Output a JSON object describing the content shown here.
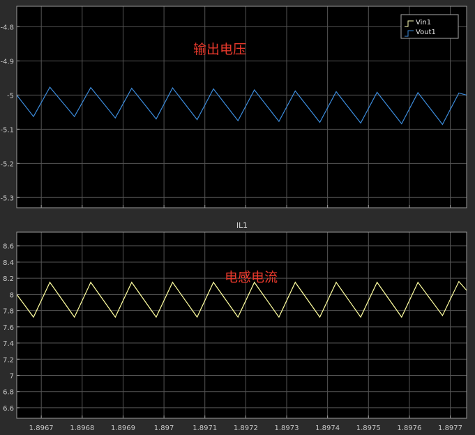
{
  "colors": {
    "figure_bg": "#2b2b2b",
    "axes_bg": "#000000",
    "grid": "#555555",
    "axis_line": "#9a9a9a",
    "tick_text": "#c8c8c8",
    "annotation": "#e8392c"
  },
  "chart_data": [
    {
      "type": "line",
      "title": "",
      "annotation": "输出电压",
      "xlim": [
        1.89664,
        1.89774
      ],
      "ylim": [
        -5.33,
        -4.74
      ],
      "yticks": [
        -4.8,
        -4.9,
        -5,
        -5.1,
        -5.2,
        -5.3
      ],
      "ytick_labels": [
        "-4.8",
        "-4.9",
        "-5",
        "-5.1",
        "-5.2",
        "-5.3"
      ],
      "xticks": [
        1.8967,
        1.8968,
        1.8969,
        1.897,
        1.8971,
        1.8972,
        1.8973,
        1.8974,
        1.8975,
        1.8976,
        1.8977
      ],
      "grid": true,
      "legend": {
        "placement": "top-right",
        "entries": [
          {
            "name": "Vin1",
            "color": "#ffffb4"
          },
          {
            "name": "Vout1",
            "color": "#3c8cdc"
          }
        ]
      },
      "series": [
        {
          "name": "Vout1",
          "color": "#3c8cdc",
          "x": [
            1.89664,
            1.896681,
            1.896721,
            1.896781,
            1.896821,
            1.896881,
            1.896921,
            1.896981,
            1.897021,
            1.897081,
            1.897121,
            1.897181,
            1.897221,
            1.897281,
            1.897321,
            1.897381,
            1.897421,
            1.897481,
            1.897521,
            1.897581,
            1.897621,
            1.897681,
            1.897721,
            1.89774
          ],
          "values": [
            -5.0,
            -5.063,
            -4.977,
            -5.063,
            -4.978,
            -5.067,
            -4.98,
            -5.07,
            -4.979,
            -5.072,
            -4.982,
            -5.075,
            -4.985,
            -5.077,
            -4.988,
            -5.08,
            -4.99,
            -5.082,
            -4.992,
            -5.084,
            -4.993,
            -5.086,
            -4.994,
            -5.0
          ]
        }
      ]
    },
    {
      "type": "line",
      "title": "IL1",
      "annotation": "电感电流",
      "xlim": [
        1.89664,
        1.89774
      ],
      "ylim": [
        6.47,
        8.77
      ],
      "yticks": [
        6.6,
        6.8,
        7,
        7.2,
        7.4,
        7.6,
        7.8,
        8,
        8.2,
        8.4,
        8.6
      ],
      "ytick_labels": [
        "6.6",
        "6.8",
        "7",
        "7.2",
        "7.4",
        "7.6",
        "7.8",
        "8",
        "8.2",
        "8.4",
        "8.6"
      ],
      "xticks": [
        1.8967,
        1.8968,
        1.8969,
        1.897,
        1.8971,
        1.8972,
        1.8973,
        1.8974,
        1.8975,
        1.8976,
        1.8977
      ],
      "xtick_labels": [
        "1.8967",
        "1.8968",
        "1.8969",
        "1.897",
        "1.8971",
        "1.8972",
        "1.8973",
        "1.8974",
        "1.8975",
        "1.8976",
        "1.8977"
      ],
      "grid": true,
      "series": [
        {
          "name": "",
          "color": "#ffffa0",
          "x": [
            1.89664,
            1.896681,
            1.896721,
            1.896781,
            1.896821,
            1.896881,
            1.896921,
            1.896981,
            1.897021,
            1.897081,
            1.897121,
            1.897181,
            1.897221,
            1.897281,
            1.897321,
            1.897381,
            1.897421,
            1.897481,
            1.897521,
            1.897581,
            1.897621,
            1.897681,
            1.897721,
            1.89774
          ],
          "values": [
            8.0,
            7.72,
            8.15,
            7.72,
            8.15,
            7.72,
            8.15,
            7.72,
            8.15,
            7.72,
            8.15,
            7.72,
            8.15,
            7.72,
            8.15,
            7.72,
            8.15,
            7.72,
            8.15,
            7.72,
            8.15,
            7.74,
            8.16,
            8.05
          ]
        }
      ]
    }
  ]
}
